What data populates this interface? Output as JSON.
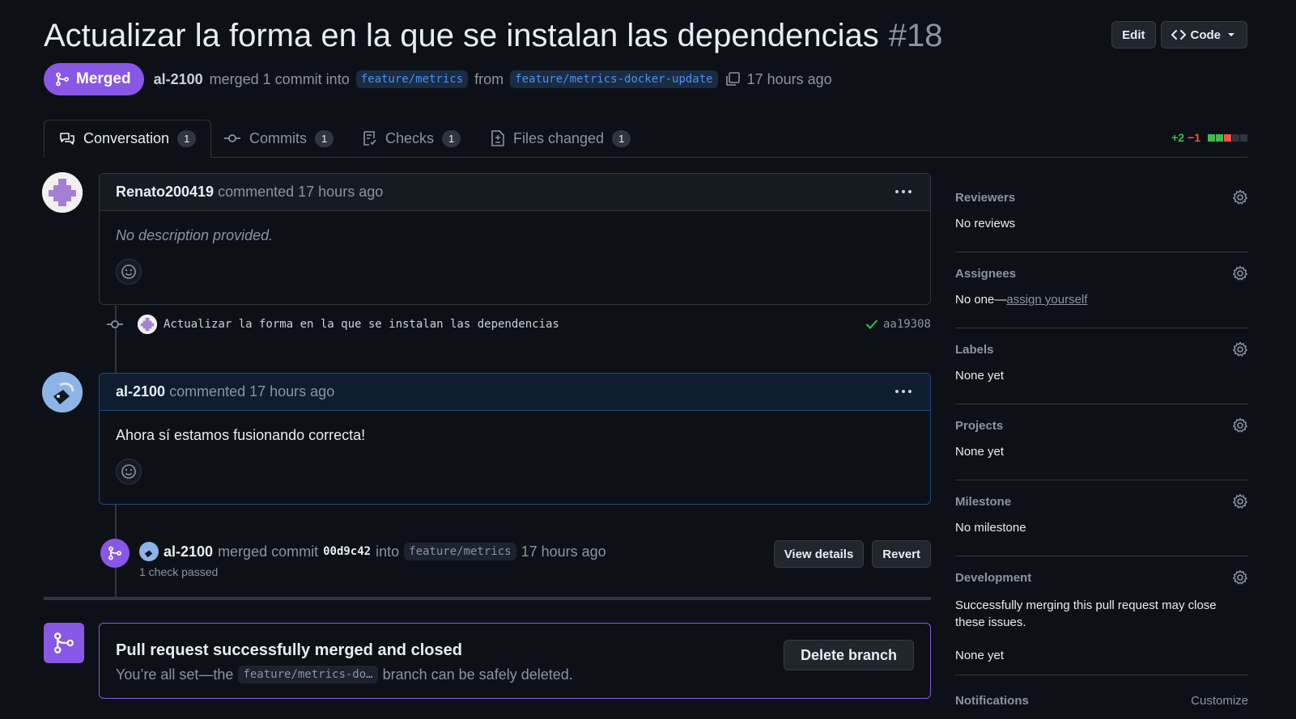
{
  "header": {
    "title": "Actualizar la forma en la que se instalan las dependencias",
    "number": "#18",
    "edit_label": "Edit",
    "code_label": "Code"
  },
  "subhead": {
    "state": "Merged",
    "author": "al-2100",
    "action": "merged 1 commit into",
    "base_branch": "feature/metrics",
    "from_label": "from",
    "head_branch": "feature/metrics-docker-update",
    "time": "17 hours ago"
  },
  "tabs": [
    {
      "label": "Conversation",
      "count": "1"
    },
    {
      "label": "Commits",
      "count": "1"
    },
    {
      "label": "Checks",
      "count": "1"
    },
    {
      "label": "Files changed",
      "count": "1"
    }
  ],
  "diffstat": {
    "additions": "+2",
    "deletions": "−1"
  },
  "comments": [
    {
      "author": "Renato200419",
      "action": "commented",
      "time": "17 hours ago",
      "body": "No description provided."
    },
    {
      "author": "al-2100",
      "action": "commented",
      "time": "17 hours ago",
      "body": "Ahora sí estamos fusionando correcta!"
    }
  ],
  "commit": {
    "message": "Actualizar la forma en la que se instalan las dependencias",
    "sha": "aa19308"
  },
  "merge_event": {
    "author": "al-2100",
    "action": "merged commit",
    "sha": "00d9c42",
    "into": "into",
    "branch": "feature/metrics",
    "time": "17 hours ago",
    "checks": "1 check passed",
    "view_details_label": "View details",
    "revert_label": "Revert"
  },
  "merged_box": {
    "title": "Pull request successfully merged and closed",
    "prefix": "You’re all set—the",
    "branch": "feature/metrics-do…",
    "suffix": "branch can be safely deleted.",
    "delete_label": "Delete branch"
  },
  "sidebar": {
    "sections": [
      {
        "title": "Reviewers",
        "value": "No reviews"
      },
      {
        "title": "Assignees",
        "value": "No one—",
        "link": "assign yourself"
      },
      {
        "title": "Labels",
        "value": "None yet"
      },
      {
        "title": "Projects",
        "value": "None yet"
      },
      {
        "title": "Milestone",
        "value": "No milestone"
      }
    ],
    "development": {
      "title": "Development",
      "description": "Successfully merging this pull request may close these issues.",
      "value": "None yet"
    },
    "notifications": {
      "title": "Notifications",
      "customize": "Customize"
    }
  },
  "colors": {
    "background": "#0d1117",
    "merged_purple": "#8957e5",
    "link_blue": "#4493f8",
    "add_green": "#3fb950",
    "delete_red": "#f85149"
  }
}
